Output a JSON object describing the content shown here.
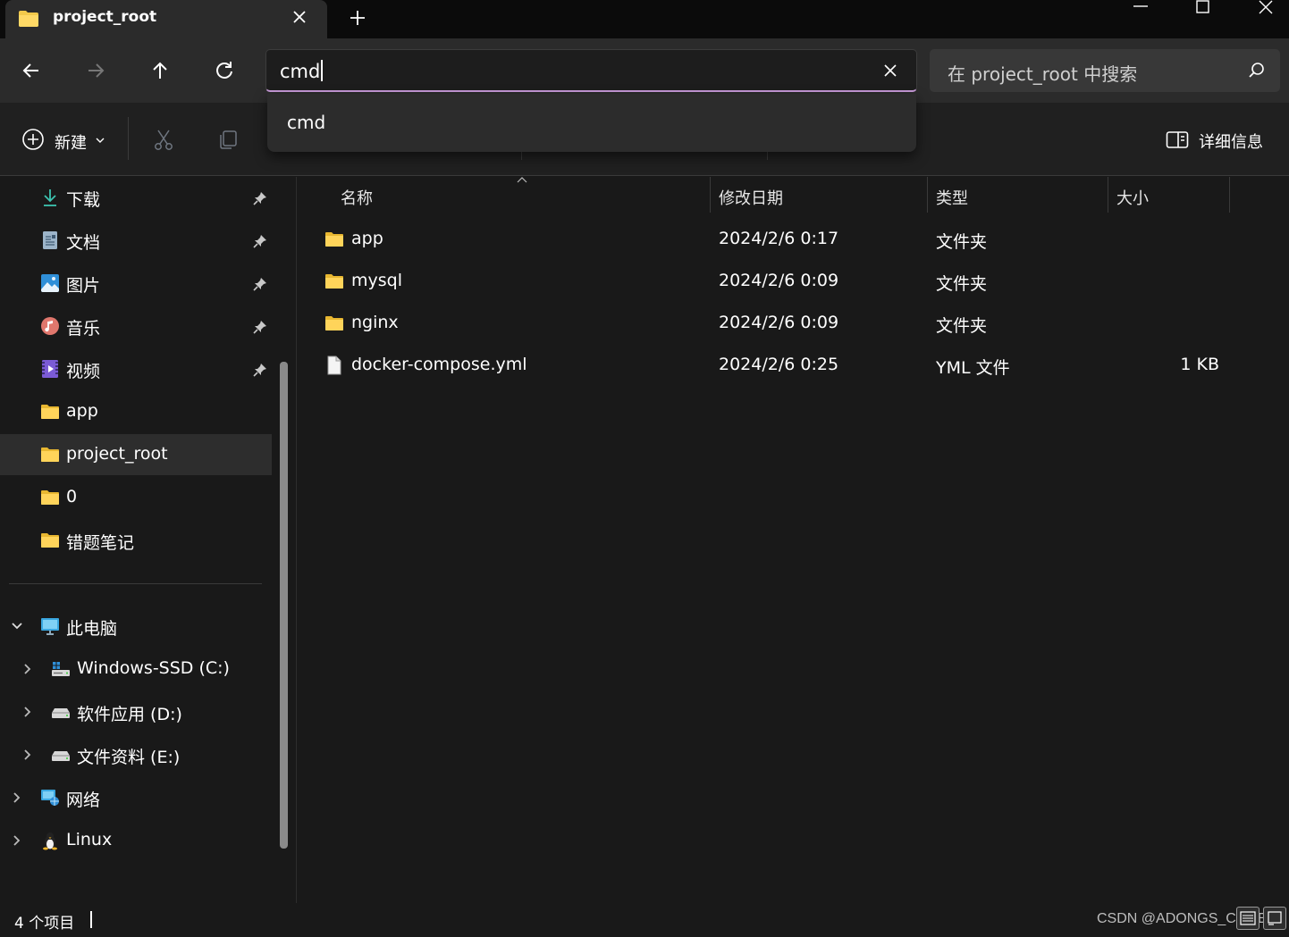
{
  "tab": {
    "title": "project_root"
  },
  "address": {
    "value": "cmd"
  },
  "search": {
    "placeholder": "在 project_root 中搜索"
  },
  "dropdown": {
    "items": [
      "cmd"
    ]
  },
  "toolbar": {
    "new_label": "新建",
    "details_label": "详细信息"
  },
  "sidebar": {
    "quick_access": [
      {
        "label": "下载",
        "icon": "download-icon",
        "pinned": true
      },
      {
        "label": "文档",
        "icon": "document-icon",
        "pinned": true
      },
      {
        "label": "图片",
        "icon": "pictures-icon",
        "pinned": true
      },
      {
        "label": "音乐",
        "icon": "music-icon",
        "pinned": true
      },
      {
        "label": "视频",
        "icon": "video-icon",
        "pinned": true
      },
      {
        "label": "app",
        "icon": "folder-icon",
        "pinned": false
      },
      {
        "label": "project_root",
        "icon": "folder-icon",
        "pinned": false,
        "selected": true
      },
      {
        "label": "0",
        "icon": "folder-icon",
        "pinned": false
      },
      {
        "label": "错题笔记",
        "icon": "folder-icon",
        "pinned": false
      }
    ],
    "this_pc": {
      "label": "此电脑",
      "icon": "computer-icon"
    },
    "drives": [
      {
        "label": "Windows-SSD (C:)",
        "icon": "system-drive-icon"
      },
      {
        "label": "软件应用 (D:)",
        "icon": "drive-icon"
      },
      {
        "label": "文件资料 (E:)",
        "icon": "drive-icon"
      }
    ],
    "network": {
      "label": "网络",
      "icon": "network-icon"
    },
    "linux": {
      "label": "Linux",
      "icon": "linux-penguin-icon"
    }
  },
  "columns": {
    "name": "名称",
    "date": "修改日期",
    "type": "类型",
    "size": "大小"
  },
  "files": [
    {
      "name": "app",
      "date": "2024/2/6 0:17",
      "type": "文件夹",
      "size": "",
      "icon": "folder-icon"
    },
    {
      "name": "mysql",
      "date": "2024/2/6 0:09",
      "type": "文件夹",
      "size": "",
      "icon": "folder-icon"
    },
    {
      "name": "nginx",
      "date": "2024/2/6 0:09",
      "type": "文件夹",
      "size": "",
      "icon": "folder-icon"
    },
    {
      "name": "docker-compose.yml",
      "date": "2024/2/6 0:25",
      "type": "YML 文件",
      "size": "1 KB",
      "icon": "file-icon"
    }
  ],
  "status": {
    "count": "4 个项目",
    "watermark": "CSDN @ADONGS_CODER"
  },
  "colors": {
    "accent": "#c79ad8",
    "folder": "#f3c94b",
    "background": "#191919"
  }
}
